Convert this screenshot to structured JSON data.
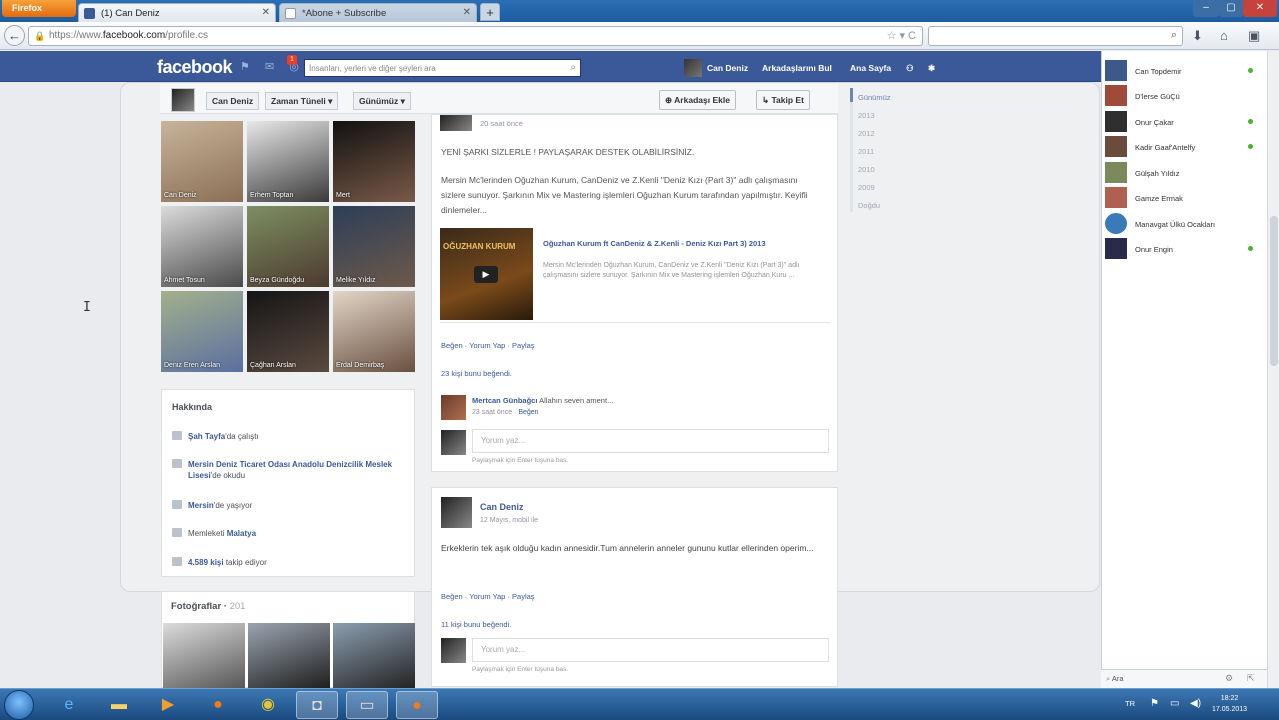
{
  "browser": {
    "menu_button": "Firefox",
    "tabs": [
      {
        "label": "(1) Can Deniz",
        "active": true
      },
      {
        "label": "*Abone + Subscribe",
        "active": false
      }
    ],
    "url_prefix": "https://www.",
    "url_domain": "facebook.com",
    "url_path": "/profile.cs"
  },
  "fb": {
    "logo": "facebook",
    "notification_count": "1",
    "search_placeholder": "İnsanları, yerleri ve diğer şeyleri ara",
    "nav": [
      "Can Deniz",
      "Arkadaşlarını Bul",
      "Ana Sayfa"
    ]
  },
  "timeline": {
    "name_btn": "Can Deniz",
    "zaman_btn": "Zaman Tüneli",
    "gunumuz_btn": "Günümüz",
    "add_friend": "Arkadaşı Ekle",
    "follow": "Takip Et"
  },
  "friends": [
    {
      "name": "Can Deniz",
      "color": "#8a6f55"
    },
    {
      "name": "Erhem Toptan",
      "color": "#3a3a3a"
    },
    {
      "name": "Mert",
      "color": "#1f1f1f"
    },
    {
      "name": "Ahmet Tosun",
      "color": "#6a6a6a"
    },
    {
      "name": "Beyza Gündoğdu",
      "color": "#5c6a48"
    },
    {
      "name": "Melike Yıldız",
      "color": "#3e5570"
    },
    {
      "name": "Deniz Eren Arslan",
      "color": "#7b6a58"
    },
    {
      "name": "Çağhan Arslan",
      "color": "#2e2e2e"
    },
    {
      "name": "Erdal Demirbaş",
      "color": "#8d7660"
    }
  ],
  "about": {
    "title": "Hakkında",
    "items": [
      {
        "bold": "Şah Tayfa",
        "text": "'da çalıştı"
      },
      {
        "bold": "Mersin Deniz Ticaret Odası Anadolu Denizcilik Meslek Lisesi",
        "text": "'de okudu"
      },
      {
        "bold": "Mersin",
        "text": "'de yaşıyor"
      },
      {
        "text": "Memleketi ",
        "bold": "Malatya"
      },
      {
        "bold": "4.589 kişi",
        "text": " takip ediyor"
      }
    ]
  },
  "photos": {
    "title": "Fotoğraflar",
    "count": "201"
  },
  "post1": {
    "time": "20 saat önce",
    "line1": "YENİ ŞARKI SİZLERLE ! PAYLAŞARAK DESTEK OLABİLİRSİNİZ.",
    "body": "Mersin Mc'lerinden Oğuzhan Kurum, CanDeniz ve Z.Kenli \"Deniz Kızı (Part 3)\" adlı çalışmasını sizlere sunuyor. Şarkının Mix ve Mastering işlemleri Oğuzhan Kurum tarafından yapılmıştır. Keyifli dinlemeler...",
    "video_title": "Oğuzhan Kurum ft CanDeniz & Z.Kenli - Deniz Kızı Part 3) 2013",
    "video_desc": "Mersin Mc'lerinden Oğuzhan Kurum, CanDeniz ve Z.Kenli \"Deniz Kızı (Part 3)\" adlı çalışmasını sizlere sunuyor. Şarkının Mix ve Mastering işlemleri Oğuzhan Kuru ...",
    "thumb_text": "OĞUZHAN KURUM",
    "actions": "Beğen · Yorum Yap · Paylaş",
    "likes": "23 kişi bunu beğendi.",
    "comment_author": "Mertcan Günbağcı",
    "comment_text": "Allahın seven ament...",
    "comment_time": "23 saat önce ·",
    "comment_like": "Beğen",
    "comment_placeholder": "Yorum yaz...",
    "comment_hint": "Paylaşmak için Enter tuşuna bas."
  },
  "post2": {
    "author": "Can Deniz",
    "time": "12 Mayıs, mobil ile",
    "body": "Erkeklerin tek aşık olduğu kadın annesidir.Tum annelerin anneler gununu kutlar ellerinden operim...",
    "actions": "Beğen · Yorum Yap · Paylaş",
    "likes": "11 kişi bunu beğendi.",
    "comment_placeholder": "Yorum yaz...",
    "comment_hint": "Paylaşmak için Enter tuşuna bas."
  },
  "years": [
    "Günümüz",
    "2013",
    "2012",
    "2011",
    "2010",
    "2009",
    "Doğdu"
  ],
  "chat": {
    "contacts": [
      {
        "name": "Can Topdemir",
        "online": true,
        "color": "#3b5a8a"
      },
      {
        "name": "D'lerse GüÇü",
        "online": false,
        "color": "#a04a3a"
      },
      {
        "name": "Onur Çakar",
        "online": true,
        "color": "#2f2f2f"
      },
      {
        "name": "Kadir Gaaf'Antelfy",
        "online": true,
        "color": "#6b4b3b"
      },
      {
        "name": "Gülşah Yıldız",
        "online": false,
        "color": "#7a8a5a"
      },
      {
        "name": "Gamze Ermak",
        "online": false,
        "color": "#b06050"
      },
      {
        "name": "Manavgat Ülkü Ocakları",
        "online": false,
        "color": "#3a7ab8"
      },
      {
        "name": "Onur Engin",
        "online": true,
        "color": "#2a2a4a"
      }
    ],
    "search_label": "Ara"
  },
  "taskbar": {
    "lang": "TR",
    "time": "18:22",
    "date": "17.05.2013"
  }
}
